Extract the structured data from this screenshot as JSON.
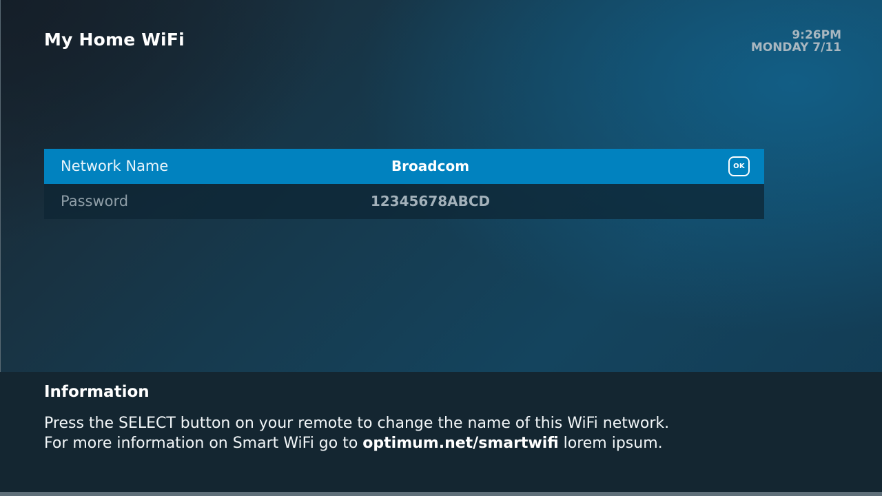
{
  "header": {
    "title": "My Home WiFi",
    "time": "9:26PM",
    "date": "MONDAY 7/11"
  },
  "settings": [
    {
      "label": "Network Name",
      "value": "Broadcom",
      "selected": true,
      "action_icon": "OK"
    },
    {
      "label": "Password",
      "value": "12345678ABCD",
      "selected": false
    }
  ],
  "info": {
    "title": "Information",
    "line1": "Press the SELECT button on your remote to change the name of this WiFi network.",
    "line2_prefix": "For more information on Smart WiFi go to ",
    "line2_link": "optimum.net/smartwifi",
    "line2_suffix": " lorem ipsum."
  },
  "colors": {
    "selected_row": "#0182bf",
    "background": "#163a4e",
    "info_panel": "#142631"
  }
}
